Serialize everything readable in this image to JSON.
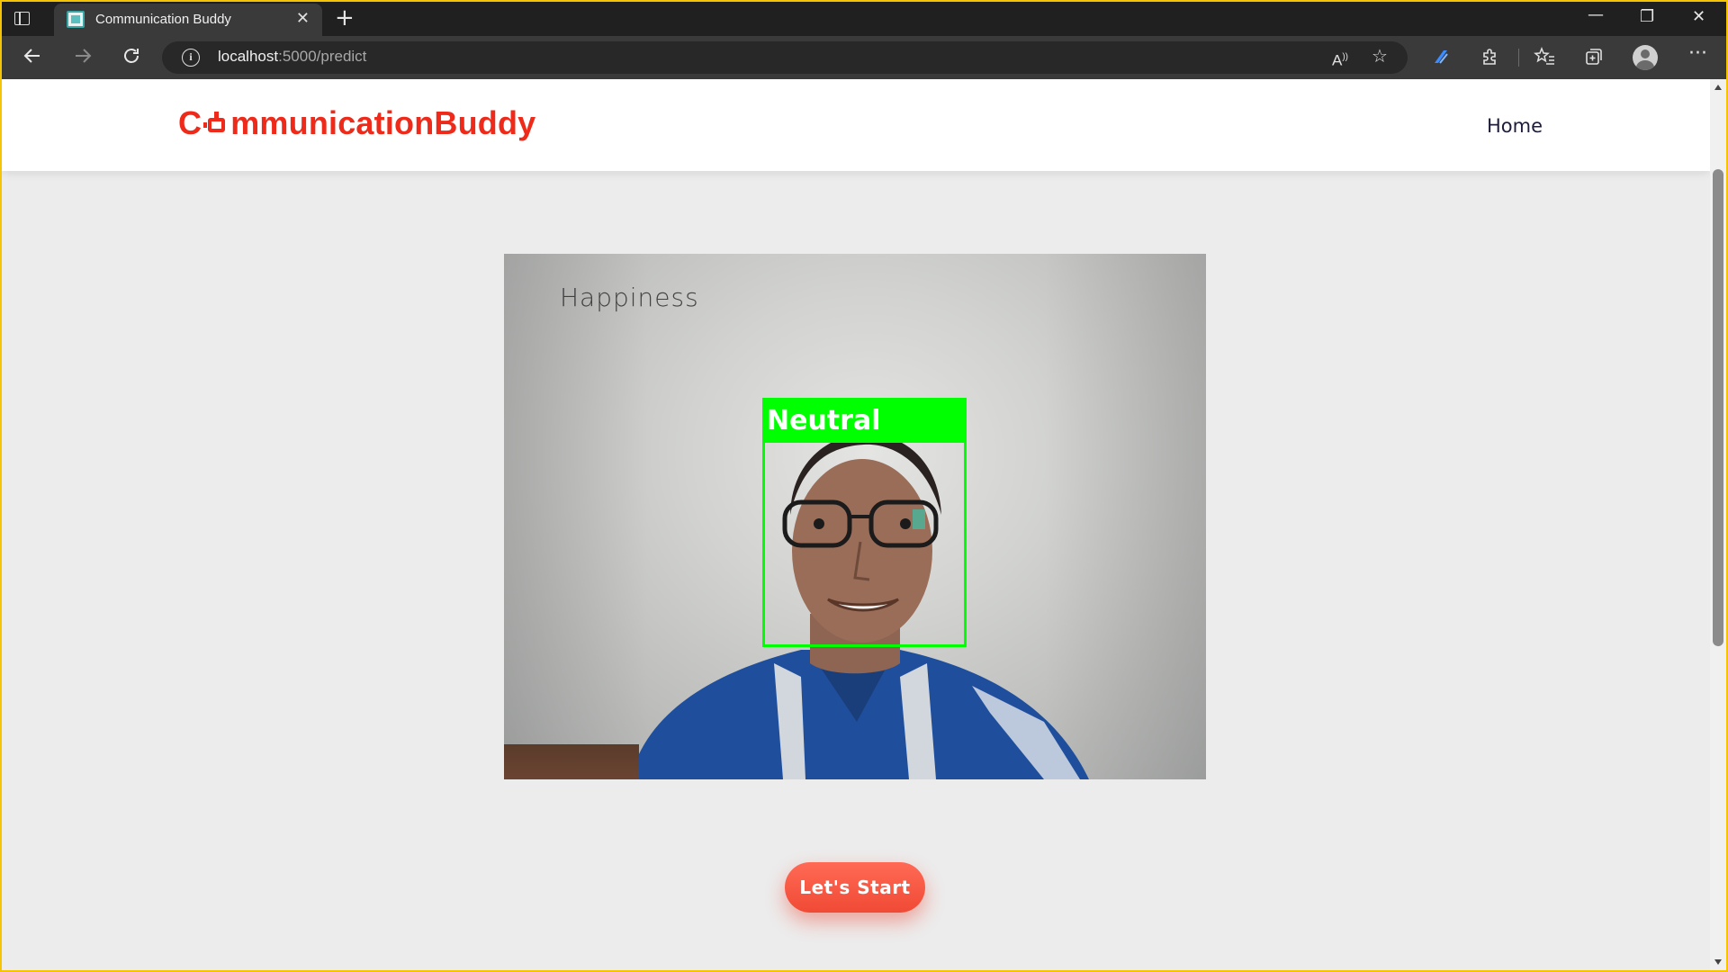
{
  "browser": {
    "tab_title": "Communication Buddy",
    "tab_close": "✕",
    "new_tab": "+",
    "url_host": "localhost",
    "url_path": ":5000/predict",
    "window_controls": {
      "minimize": "—",
      "restore": "❐",
      "close": "✕"
    },
    "toolbar_icons": [
      "back-icon",
      "forward-icon",
      "refresh-icon",
      "info-icon",
      "read-aloud-icon",
      "add-favorite-icon",
      "copilot-icon",
      "extensions-icon",
      "favorites-icon",
      "collections-icon",
      "profile-icon",
      "more-icon"
    ]
  },
  "site": {
    "brand_before": "C",
    "brand_after": "mmunicationBuddy",
    "brand_color": "#ee2b1a",
    "nav_home": "Home"
  },
  "camera": {
    "target_emotion": "Happiness",
    "detected_emotion": "Neutral",
    "box_color": "#00ff00"
  },
  "cta": {
    "label": "Let's Start"
  }
}
